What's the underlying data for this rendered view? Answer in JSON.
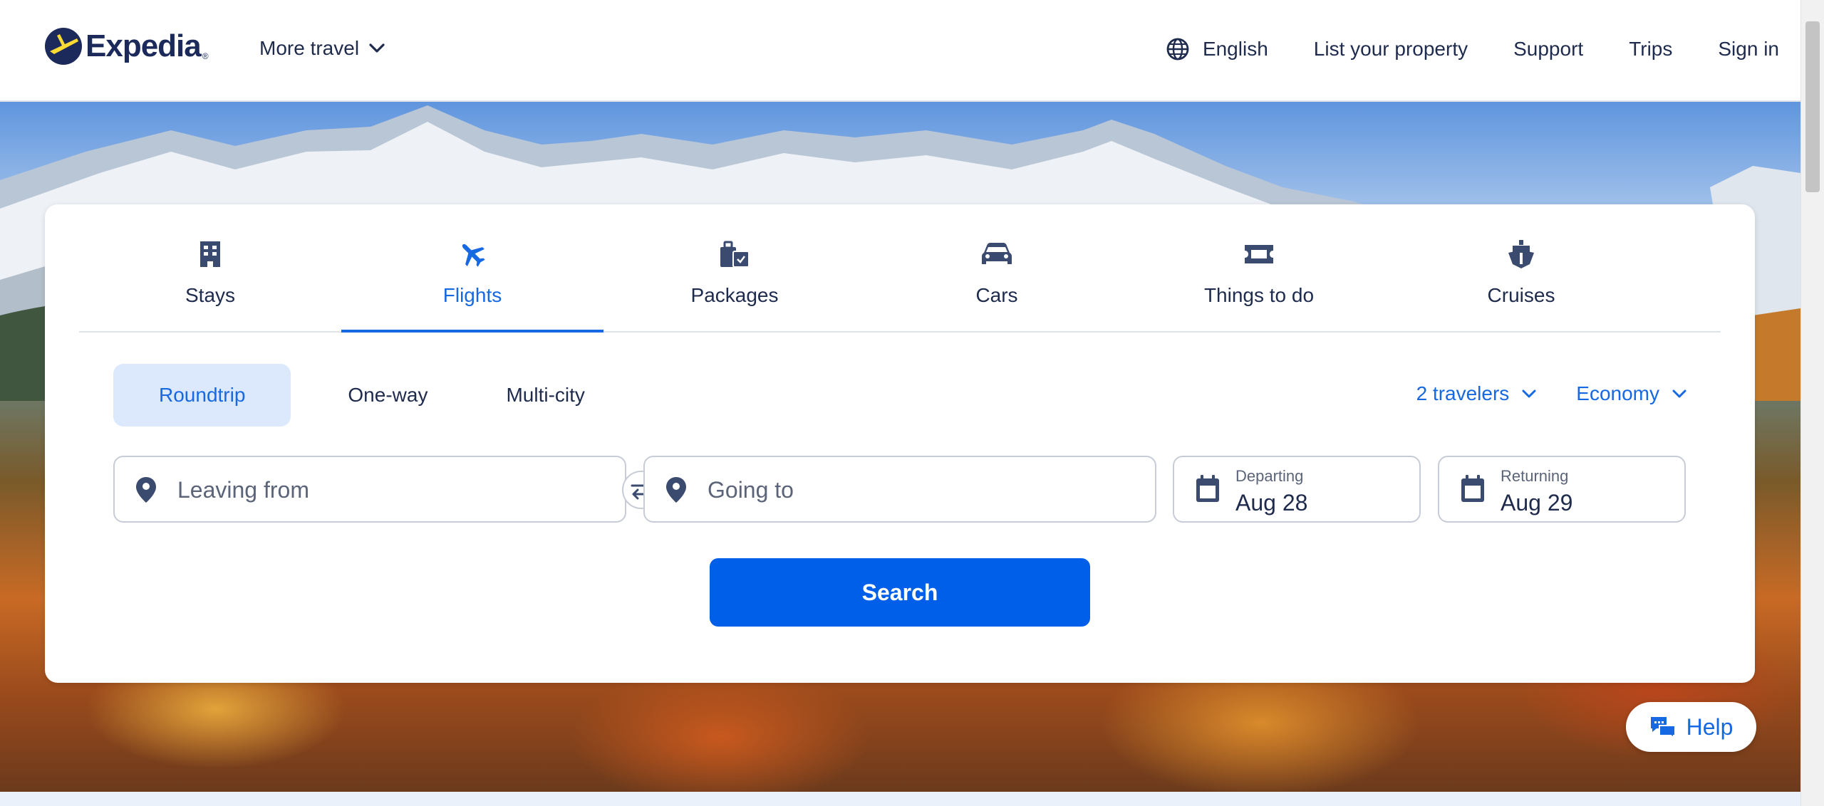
{
  "colors": {
    "accent": "#1668e3",
    "brand_navy": "#1b2a5b",
    "search_button": "#005fe8",
    "logo_yellow": "#fddb32",
    "active_trip_bg": "#dce9fc"
  },
  "header": {
    "logo_text": "Expedia",
    "more_travel": "More travel",
    "language": "English",
    "list_property": "List your property",
    "support": "Support",
    "trips": "Trips",
    "sign_in": "Sign in"
  },
  "tabs": [
    {
      "label": "Stays",
      "icon": "building-icon",
      "active": false
    },
    {
      "label": "Flights",
      "icon": "plane-icon",
      "active": true
    },
    {
      "label": "Packages",
      "icon": "luggage-icon",
      "active": false
    },
    {
      "label": "Cars",
      "icon": "car-icon",
      "active": false
    },
    {
      "label": "Things to do",
      "icon": "ticket-icon",
      "active": false
    },
    {
      "label": "Cruises",
      "icon": "ship-icon",
      "active": false
    }
  ],
  "trip_types": [
    "Roundtrip",
    "One-way",
    "Multi-city"
  ],
  "trip_type_selected": "Roundtrip",
  "travelers": "2 travelers",
  "cabin_class": "Economy",
  "fields": {
    "leaving_from": {
      "placeholder": "Leaving from",
      "value": ""
    },
    "going_to": {
      "placeholder": "Going to",
      "value": ""
    },
    "departing": {
      "label": "Departing",
      "value": "Aug 28"
    },
    "returning": {
      "label": "Returning",
      "value": "Aug 29"
    }
  },
  "search_button": "Search",
  "help_button": "Help"
}
